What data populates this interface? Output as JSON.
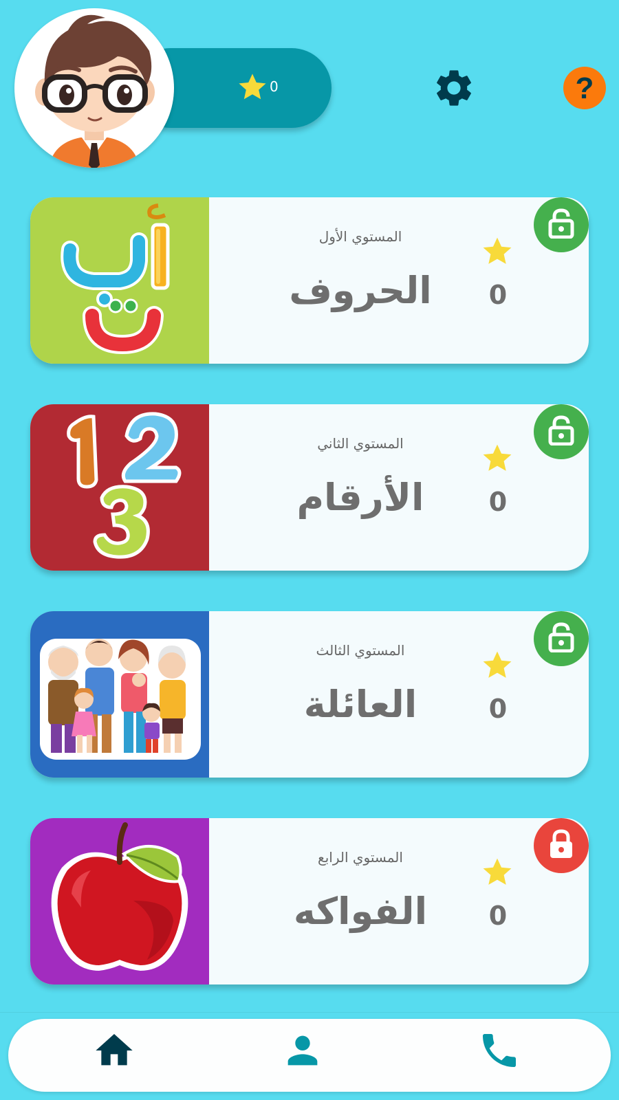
{
  "header": {
    "score": "0",
    "icons": {
      "score": "star-icon",
      "settings": "gear-icon",
      "help": "question-mark-icon",
      "avatar": "boy-character-avatar"
    }
  },
  "levels": [
    {
      "subtitle": "المستوي الأول",
      "title": "الحروف",
      "stars": "0",
      "lock_state": "unlocked",
      "lock_color": "#45b04d",
      "image_bg": "#afd44a",
      "image": "arabic-letters-illustration"
    },
    {
      "subtitle": "المستوي الثاني",
      "title": "الأرقام",
      "stars": "0",
      "lock_state": "unlocked",
      "lock_color": "#45b04d",
      "image_bg": "#b22a33",
      "image": "numbers-123-illustration"
    },
    {
      "subtitle": "المستوي الثالث",
      "title": "العائلة",
      "stars": "0",
      "lock_state": "unlocked",
      "lock_color": "#45b04d",
      "image_bg": "#2a6cc1",
      "image": "family-illustration"
    },
    {
      "subtitle": "المستوي الرابع",
      "title": "الفواكه",
      "stars": "0",
      "lock_state": "locked",
      "lock_color": "#e9453c",
      "image_bg": "#a22cbf",
      "image": "red-apple-illustration"
    }
  ],
  "bottom_nav": {
    "items": [
      {
        "icon": "home-icon",
        "active": true
      },
      {
        "icon": "person-icon",
        "active": false
      },
      {
        "icon": "phone-icon",
        "active": false
      }
    ]
  },
  "colors": {
    "background": "#57dcef",
    "score_pill": "#0797a7",
    "star": "#f8da3a",
    "dark_icon": "#003b4c",
    "help": "#fb7a0c",
    "nav_active": "#003b4c",
    "nav_inactive": "#0797a7"
  }
}
